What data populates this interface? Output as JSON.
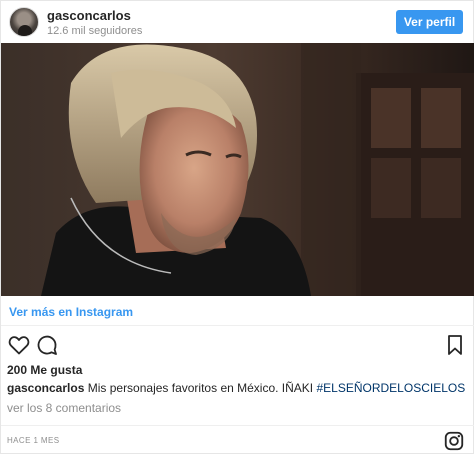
{
  "header": {
    "username": "gasconcarlos",
    "followers": "12.6 mil seguidores",
    "profile_button": "Ver perfil"
  },
  "view_more": "Ver más en Instagram",
  "likes": "200 Me gusta",
  "caption": {
    "username": "gasconcarlos",
    "text": "Mis personajes favoritos en México. IÑAKI",
    "hashtag": "#ELSEÑORDELOSCIELOS"
  },
  "comments_link": "ver los 8 comentarios",
  "timestamp": "HACE 1 MES",
  "icons": {
    "like": "heart-icon",
    "comment": "speech-bubble-icon",
    "save": "bookmark-icon",
    "brand": "instagram-icon"
  },
  "colors": {
    "accent": "#3897f0",
    "hashtag": "#003569",
    "muted": "#8e8e8e"
  }
}
